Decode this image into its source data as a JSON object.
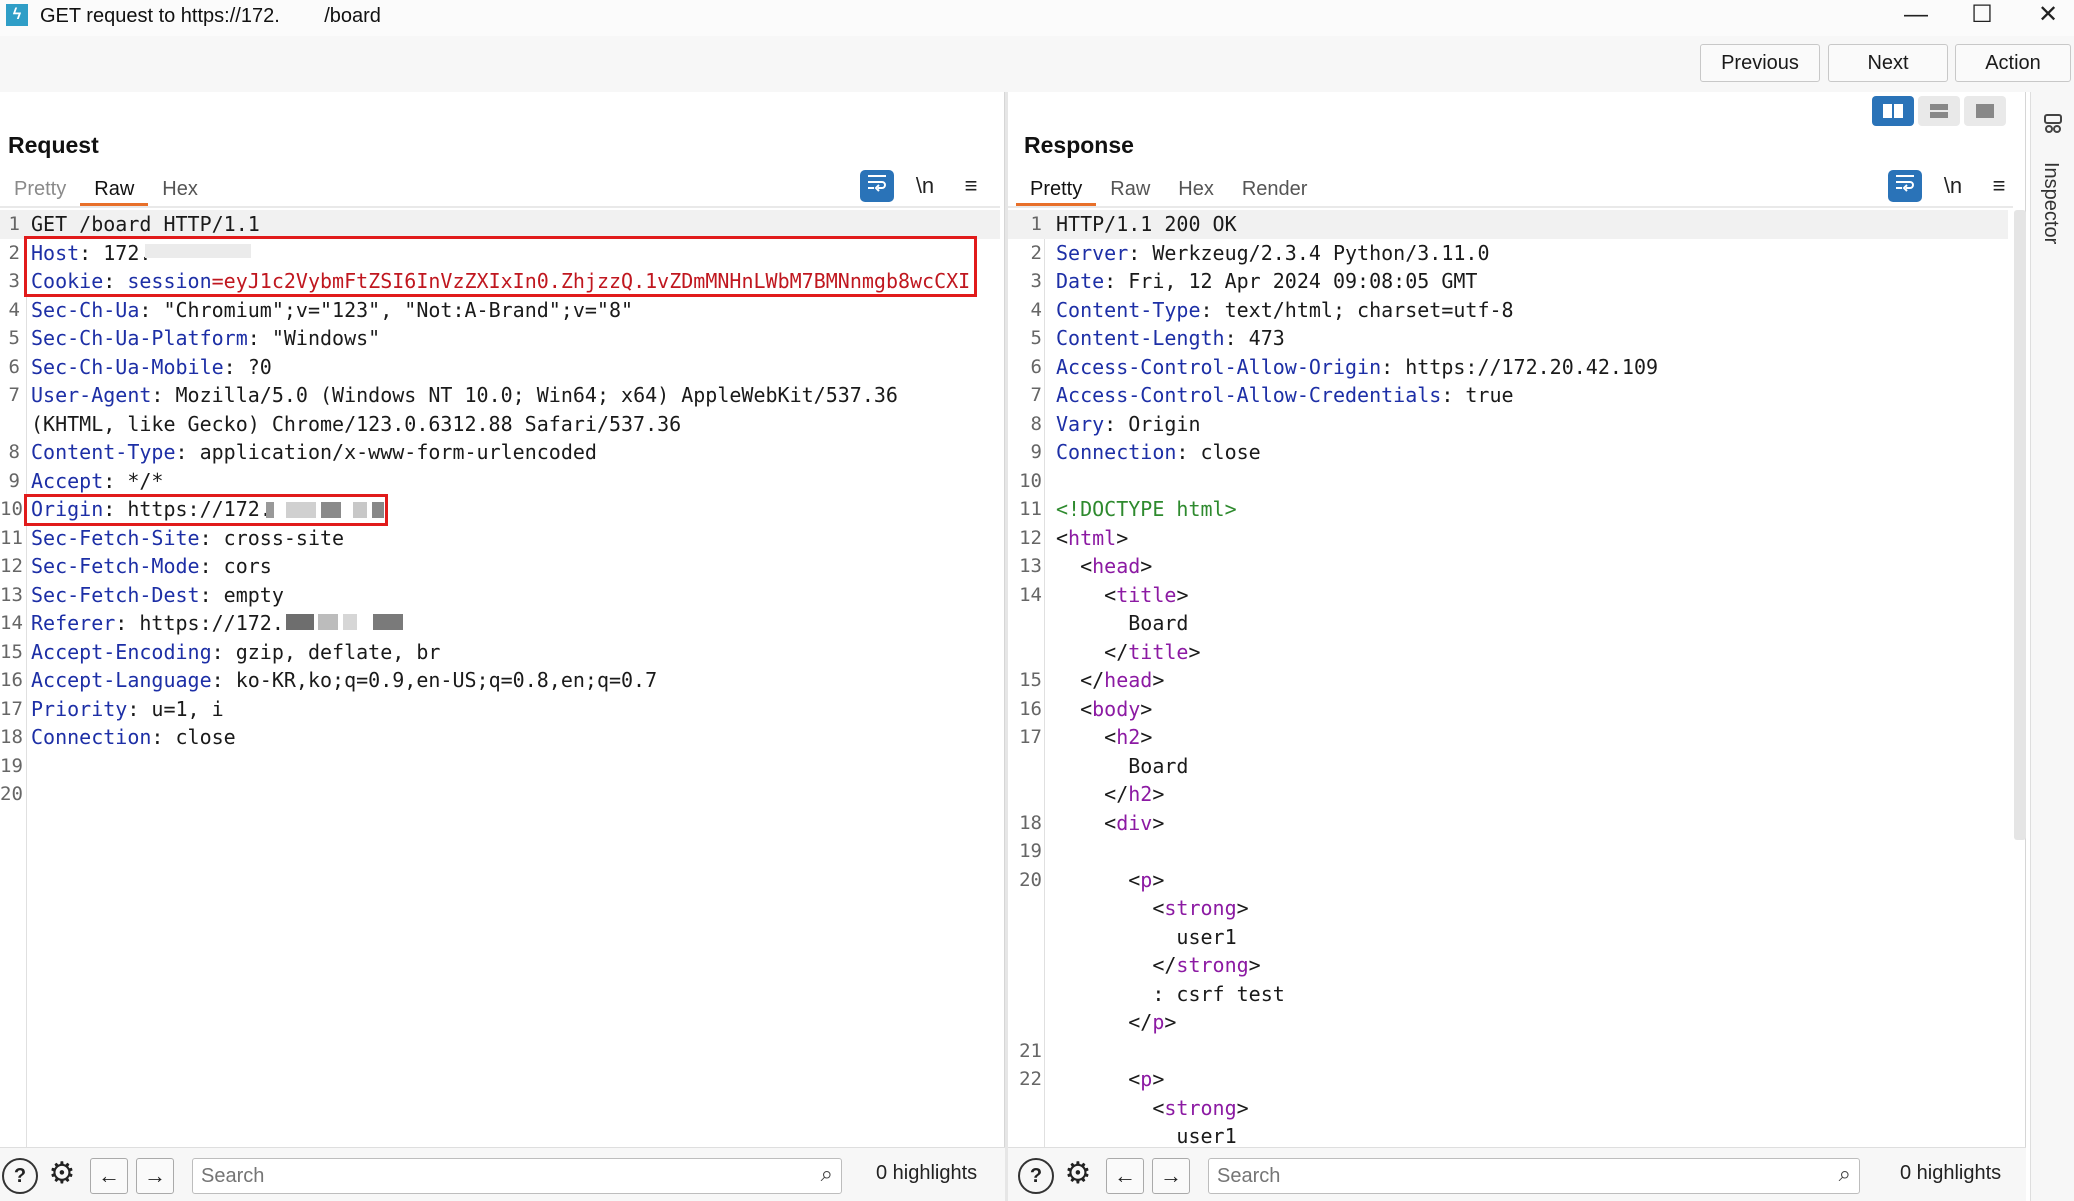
{
  "window": {
    "title": "GET request to https://172.        /board",
    "minimize": "—",
    "maximize": "☐",
    "close": "✕"
  },
  "toolbar": {
    "previous": "Previous",
    "next": "Next",
    "action": "Action"
  },
  "request": {
    "title": "Request",
    "tabs": [
      "Pretty",
      "Raw",
      "Hex"
    ],
    "active_tab": "Raw",
    "lines": [
      {
        "n": "1",
        "parts": [
          {
            "t": "GET /board HTTP/1.1",
            "c": "plain"
          }
        ]
      },
      {
        "n": "2",
        "parts": [
          {
            "t": "Host",
            "c": "key"
          },
          {
            "t": ": 172.",
            "c": "plain"
          }
        ]
      },
      {
        "n": "3",
        "parts": [
          {
            "t": "Cookie",
            "c": "key"
          },
          {
            "t": ": ",
            "c": "plain"
          },
          {
            "t": "session",
            "c": "key"
          },
          {
            "t": "=eyJ1c2VybmFtZSI6InVzZXIxIn0.ZhjzzQ.1vZDmMNHnLWbM7BMNnmgb8wcCXI",
            "c": "red"
          }
        ]
      },
      {
        "n": "4",
        "parts": [
          {
            "t": "Sec-Ch-Ua",
            "c": "key"
          },
          {
            "t": ": \"Chromium\";v=\"123\", \"Not:A-Brand\";v=\"8\"",
            "c": "plain"
          }
        ]
      },
      {
        "n": "5",
        "parts": [
          {
            "t": "Sec-Ch-Ua-Platform",
            "c": "key"
          },
          {
            "t": ": \"Windows\"",
            "c": "plain"
          }
        ]
      },
      {
        "n": "6",
        "parts": [
          {
            "t": "Sec-Ch-Ua-Mobile",
            "c": "key"
          },
          {
            "t": ": ?0",
            "c": "plain"
          }
        ]
      },
      {
        "n": "7",
        "parts": [
          {
            "t": "User-Agent",
            "c": "key"
          },
          {
            "t": ": Mozilla/5.0 (Windows NT 10.0; Win64; x64) AppleWebKit/537.36",
            "c": "plain"
          }
        ]
      },
      {
        "n": "",
        "parts": [
          {
            "t": "(KHTML, like Gecko) Chrome/123.0.6312.88 Safari/537.36",
            "c": "plain"
          }
        ]
      },
      {
        "n": "8",
        "parts": [
          {
            "t": "Content-Type",
            "c": "key"
          },
          {
            "t": ": application/x-www-form-urlencoded",
            "c": "plain"
          }
        ]
      },
      {
        "n": "9",
        "parts": [
          {
            "t": "Accept",
            "c": "key"
          },
          {
            "t": ": */*",
            "c": "plain"
          }
        ]
      },
      {
        "n": "10",
        "parts": [
          {
            "t": "Origin",
            "c": "key"
          },
          {
            "t": ": https://172.",
            "c": "plain"
          }
        ]
      },
      {
        "n": "11",
        "parts": [
          {
            "t": "Sec-Fetch-Site",
            "c": "key"
          },
          {
            "t": ": cross-site",
            "c": "plain"
          }
        ]
      },
      {
        "n": "12",
        "parts": [
          {
            "t": "Sec-Fetch-Mode",
            "c": "key"
          },
          {
            "t": ": cors",
            "c": "plain"
          }
        ]
      },
      {
        "n": "13",
        "parts": [
          {
            "t": "Sec-Fetch-Dest",
            "c": "key"
          },
          {
            "t": ": empty",
            "c": "plain"
          }
        ]
      },
      {
        "n": "14",
        "parts": [
          {
            "t": "Referer",
            "c": "key"
          },
          {
            "t": ": https://172.",
            "c": "plain"
          }
        ]
      },
      {
        "n": "15",
        "parts": [
          {
            "t": "Accept-Encoding",
            "c": "key"
          },
          {
            "t": ": gzip, deflate, br",
            "c": "plain"
          }
        ]
      },
      {
        "n": "16",
        "parts": [
          {
            "t": "Accept-Language",
            "c": "key"
          },
          {
            "t": ": ko-KR,ko;q=0.9,en-US;q=0.8,en;q=0.7",
            "c": "plain"
          }
        ]
      },
      {
        "n": "17",
        "parts": [
          {
            "t": "Priority",
            "c": "key"
          },
          {
            "t": ": u=1, i",
            "c": "plain"
          }
        ]
      },
      {
        "n": "18",
        "parts": [
          {
            "t": "Connection",
            "c": "key"
          },
          {
            "t": ": close",
            "c": "plain"
          }
        ]
      },
      {
        "n": "19",
        "parts": []
      },
      {
        "n": "20",
        "parts": []
      }
    ],
    "search_placeholder": "Search",
    "highlights": "0 highlights"
  },
  "response": {
    "title": "Response",
    "tabs": [
      "Pretty",
      "Raw",
      "Hex",
      "Render"
    ],
    "active_tab": "Pretty",
    "lines": [
      {
        "n": "1",
        "parts": [
          {
            "t": "HTTP/1.1 200 OK",
            "c": "plain"
          }
        ]
      },
      {
        "n": "2",
        "parts": [
          {
            "t": "Server",
            "c": "key"
          },
          {
            "t": ": Werkzeug/2.3.4 Python/3.11.0",
            "c": "plain"
          }
        ]
      },
      {
        "n": "3",
        "parts": [
          {
            "t": "Date",
            "c": "key"
          },
          {
            "t": ": Fri, 12 Apr 2024 09:08:05 GMT",
            "c": "plain"
          }
        ]
      },
      {
        "n": "4",
        "parts": [
          {
            "t": "Content-Type",
            "c": "key"
          },
          {
            "t": ": text/html; charset=utf-8",
            "c": "plain"
          }
        ]
      },
      {
        "n": "5",
        "parts": [
          {
            "t": "Content-Length",
            "c": "key"
          },
          {
            "t": ": 473",
            "c": "plain"
          }
        ]
      },
      {
        "n": "6",
        "parts": [
          {
            "t": "Access-Control-Allow-Origin",
            "c": "key"
          },
          {
            "t": ": https://172.20.42.109",
            "c": "plain"
          }
        ]
      },
      {
        "n": "7",
        "parts": [
          {
            "t": "Access-Control-Allow-Credentials",
            "c": "key"
          },
          {
            "t": ": true",
            "c": "plain"
          }
        ]
      },
      {
        "n": "8",
        "parts": [
          {
            "t": "Vary",
            "c": "key"
          },
          {
            "t": ": Origin",
            "c": "plain"
          }
        ]
      },
      {
        "n": "9",
        "parts": [
          {
            "t": "Connection",
            "c": "key"
          },
          {
            "t": ": close",
            "c": "plain"
          }
        ]
      },
      {
        "n": "10",
        "parts": []
      },
      {
        "n": "11",
        "parts": [
          {
            "t": "<!DOCTYPE html>",
            "c": "doctype"
          }
        ]
      },
      {
        "n": "12",
        "parts": [
          {
            "t": "<",
            "c": "plain"
          },
          {
            "t": "html",
            "c": "tag"
          },
          {
            "t": ">",
            "c": "plain"
          }
        ]
      },
      {
        "n": "13",
        "parts": [
          {
            "t": "  <",
            "c": "plain"
          },
          {
            "t": "head",
            "c": "tag"
          },
          {
            "t": ">",
            "c": "plain"
          }
        ]
      },
      {
        "n": "14",
        "parts": [
          {
            "t": "    <",
            "c": "plain"
          },
          {
            "t": "title",
            "c": "tag"
          },
          {
            "t": ">",
            "c": "plain"
          }
        ]
      },
      {
        "n": "",
        "parts": [
          {
            "t": "      Board",
            "c": "plain"
          }
        ]
      },
      {
        "n": "",
        "parts": [
          {
            "t": "    </",
            "c": "plain"
          },
          {
            "t": "title",
            "c": "tag"
          },
          {
            "t": ">",
            "c": "plain"
          }
        ]
      },
      {
        "n": "15",
        "parts": [
          {
            "t": "  </",
            "c": "plain"
          },
          {
            "t": "head",
            "c": "tag"
          },
          {
            "t": ">",
            "c": "plain"
          }
        ]
      },
      {
        "n": "16",
        "parts": [
          {
            "t": "  <",
            "c": "plain"
          },
          {
            "t": "body",
            "c": "tag"
          },
          {
            "t": ">",
            "c": "plain"
          }
        ]
      },
      {
        "n": "17",
        "parts": [
          {
            "t": "    <",
            "c": "plain"
          },
          {
            "t": "h2",
            "c": "tag"
          },
          {
            "t": ">",
            "c": "plain"
          }
        ]
      },
      {
        "n": "",
        "parts": [
          {
            "t": "      Board",
            "c": "plain"
          }
        ]
      },
      {
        "n": "",
        "parts": [
          {
            "t": "    </",
            "c": "plain"
          },
          {
            "t": "h2",
            "c": "tag"
          },
          {
            "t": ">",
            "c": "plain"
          }
        ]
      },
      {
        "n": "18",
        "parts": [
          {
            "t": "    <",
            "c": "plain"
          },
          {
            "t": "div",
            "c": "tag"
          },
          {
            "t": ">",
            "c": "plain"
          }
        ]
      },
      {
        "n": "19",
        "parts": []
      },
      {
        "n": "20",
        "parts": [
          {
            "t": "      <",
            "c": "plain"
          },
          {
            "t": "p",
            "c": "tag"
          },
          {
            "t": ">",
            "c": "plain"
          }
        ]
      },
      {
        "n": "",
        "parts": [
          {
            "t": "        <",
            "c": "plain"
          },
          {
            "t": "strong",
            "c": "tag"
          },
          {
            "t": ">",
            "c": "plain"
          }
        ]
      },
      {
        "n": "",
        "parts": [
          {
            "t": "          user1",
            "c": "plain"
          }
        ]
      },
      {
        "n": "",
        "parts": [
          {
            "t": "        </",
            "c": "plain"
          },
          {
            "t": "strong",
            "c": "tag"
          },
          {
            "t": ">",
            "c": "plain"
          }
        ]
      },
      {
        "n": "",
        "parts": [
          {
            "t": "        : csrf test",
            "c": "plain"
          }
        ]
      },
      {
        "n": "",
        "parts": [
          {
            "t": "      </",
            "c": "plain"
          },
          {
            "t": "p",
            "c": "tag"
          },
          {
            "t": ">",
            "c": "plain"
          }
        ]
      },
      {
        "n": "21",
        "parts": []
      },
      {
        "n": "22",
        "parts": [
          {
            "t": "      <",
            "c": "plain"
          },
          {
            "t": "p",
            "c": "tag"
          },
          {
            "t": ">",
            "c": "plain"
          }
        ]
      },
      {
        "n": "",
        "parts": [
          {
            "t": "        <",
            "c": "plain"
          },
          {
            "t": "strong",
            "c": "tag"
          },
          {
            "t": ">",
            "c": "plain"
          }
        ]
      },
      {
        "n": "",
        "parts": [
          {
            "t": "          user1",
            "c": "plain"
          }
        ]
      }
    ],
    "search_placeholder": "Search",
    "highlights": "0 highlights"
  },
  "inspector": {
    "label": "Inspector"
  },
  "icons": {
    "app": "burp-icon",
    "wrap": "word-wrap-icon",
    "newline": "\\n",
    "menu": "hamburger-menu-icon",
    "help": "?",
    "settings": "⚙",
    "back": "←",
    "forward": "→",
    "search": "⌕"
  },
  "colors": {
    "accent_tab": "#e8702a",
    "highlight_box": "#e11b1b",
    "header_key": "#1d2fa6",
    "tag": "#8c1aa3",
    "toggle_active": "#2a73b8"
  }
}
